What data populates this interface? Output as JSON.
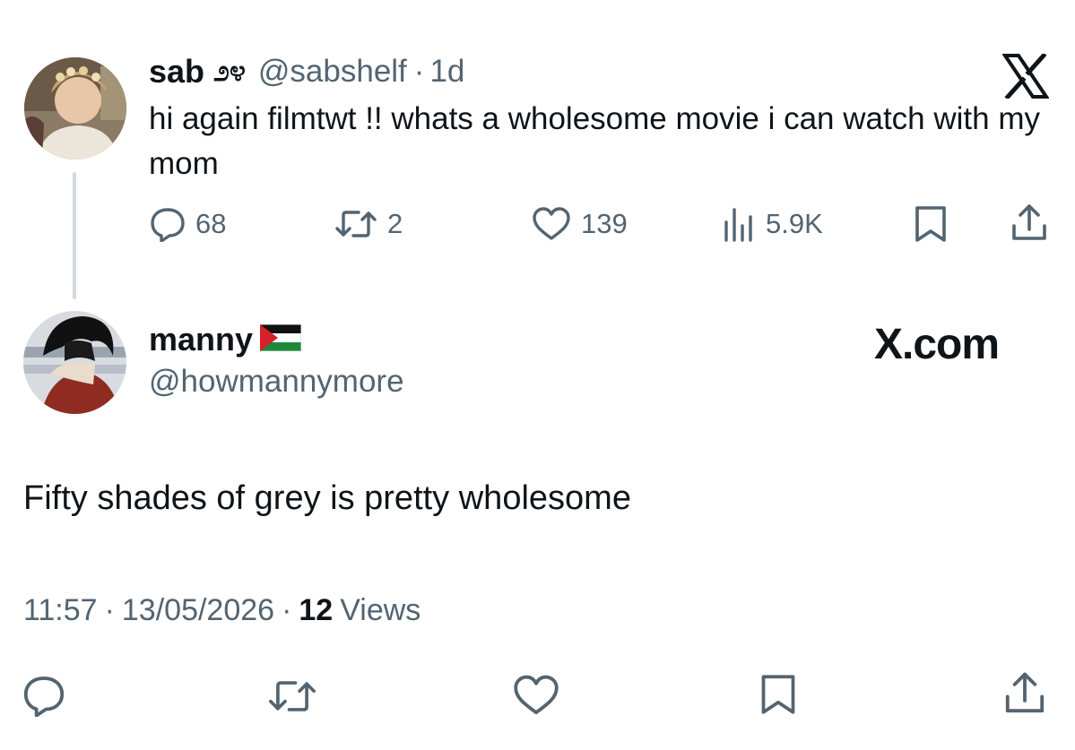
{
  "original_tweet": {
    "display_name": "sab",
    "name_emoji": "೨೪",
    "handle": "@sabshelf",
    "separator": "·",
    "age": "1d",
    "text": "hi again filmtwt !! whats a wholesome movie i can watch with my mom",
    "metrics": {
      "replies": "68",
      "reposts": "2",
      "likes": "139",
      "views": "5.9K"
    }
  },
  "reply_tweet": {
    "display_name": "manny",
    "flag": "palestine-flag",
    "handle": "@howmannymore",
    "text": "Fifty shades of grey is pretty wholesome",
    "time": "11:57",
    "date": "13/05/2026",
    "views_count": "12",
    "views_label": "Views",
    "sep1": "·",
    "sep2": "·"
  },
  "branding": {
    "site": "X.com"
  },
  "colors": {
    "text": "#0f1419",
    "muted": "#536471",
    "thread_line": "#cfd9de"
  }
}
